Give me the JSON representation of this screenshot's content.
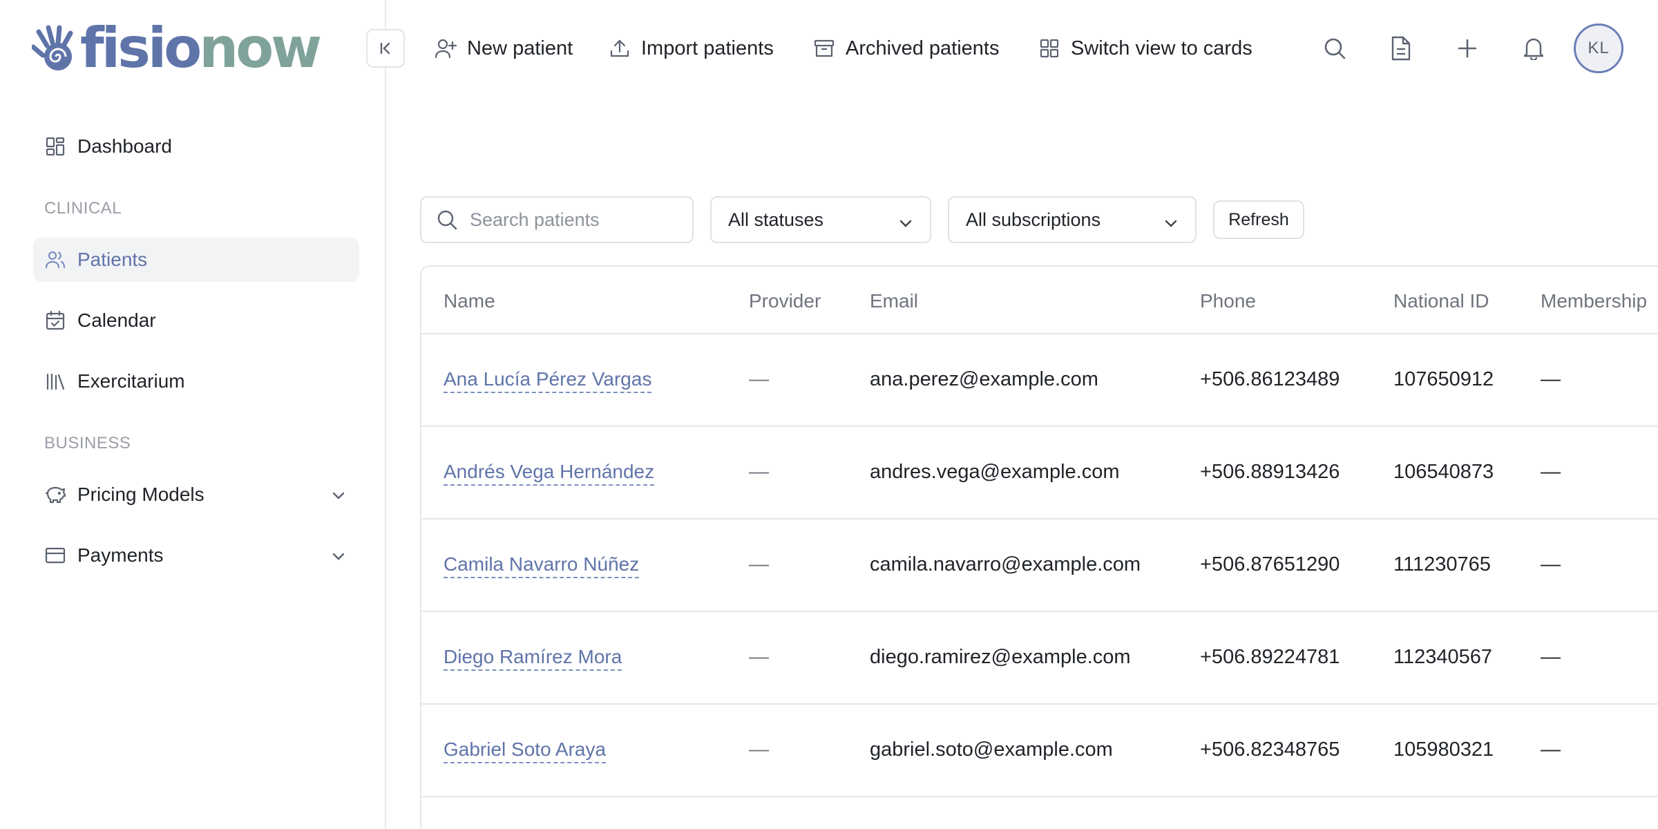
{
  "brand": {
    "part1": "fisio",
    "part2": "now"
  },
  "sidebar": {
    "dashboard": "Dashboard",
    "clinical_label": "CLINICAL",
    "patients": "Patients",
    "calendar": "Calendar",
    "exercitarium": "Exercitarium",
    "business_label": "BUSINESS",
    "pricing_models": "Pricing Models",
    "payments": "Payments"
  },
  "toolbar": {
    "new_patient": "New patient",
    "import_patients": "Import patients",
    "archived_patients": "Archived patients",
    "switch_view": "Switch view to cards",
    "avatar_initials": "KL"
  },
  "filters": {
    "search_placeholder": "Search patients",
    "status": "All statuses",
    "subscription": "All subscriptions",
    "refresh": "Refresh"
  },
  "table": {
    "columns": [
      "Name",
      "Provider",
      "Email",
      "Phone",
      "National ID",
      "Membership"
    ],
    "rows": [
      [
        "Ana Lucía Pérez Vargas",
        "—",
        "ana.perez@example.com",
        "+506.86123489",
        "107650912",
        "—"
      ],
      [
        "Andrés Vega Hernández",
        "—",
        "andres.vega@example.com",
        "+506.88913426",
        "106540873",
        "—"
      ],
      [
        "Camila Navarro Núñez",
        "—",
        "camila.navarro@example.com",
        "+506.87651290",
        "111230765",
        "—"
      ],
      [
        "Diego Ramírez Mora",
        "—",
        "diego.ramirez@example.com",
        "+506.89224781",
        "112340567",
        "—"
      ],
      [
        "Gabriel Soto Araya",
        "—",
        "gabriel.soto@example.com",
        "+506.82348765",
        "105980321",
        "—"
      ]
    ]
  }
}
